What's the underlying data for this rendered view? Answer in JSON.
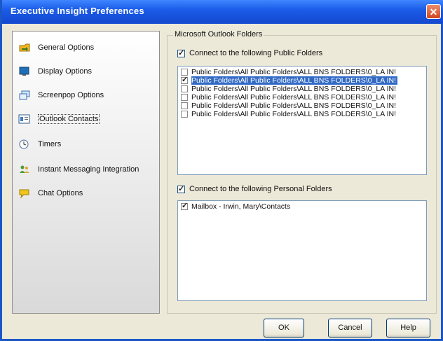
{
  "window": {
    "title": "Executive Insight Preferences",
    "close_glyph": "✕"
  },
  "sidebar": {
    "items": [
      {
        "label": "General Options",
        "icon": "folder-arrow-icon"
      },
      {
        "label": "Display Options",
        "icon": "monitor-icon"
      },
      {
        "label": "Screenpop Options",
        "icon": "screenpop-icon"
      },
      {
        "label": "Outlook Contacts",
        "icon": "contact-card-icon",
        "selected": true
      },
      {
        "label": "Timers",
        "icon": "clock-icon"
      },
      {
        "label": "Instant Messaging Integration",
        "icon": "users-icon"
      },
      {
        "label": "Chat Options",
        "icon": "chat-bubble-icon"
      }
    ]
  },
  "outlook": {
    "group_title": "Microsoft Outlook Folders",
    "public": {
      "label": "Connect to the following Public Folders",
      "checked": true,
      "folders": [
        {
          "text": "Public Folders\\All Public Folders\\ALL BNS FOLDERS\\0_LA IN!",
          "checked": false,
          "selected": false
        },
        {
          "text": "Public Folders\\All Public Folders\\ALL BNS FOLDERS\\0_LA IN!",
          "checked": true,
          "selected": true
        },
        {
          "text": "Public Folders\\All Public Folders\\ALL BNS FOLDERS\\0_LA IN!",
          "checked": false,
          "selected": false
        },
        {
          "text": "Public Folders\\All Public Folders\\ALL BNS FOLDERS\\0_LA IN!",
          "checked": false,
          "selected": false
        },
        {
          "text": "Public Folders\\All Public Folders\\ALL BNS FOLDERS\\0_LA IN!",
          "checked": false,
          "selected": false
        },
        {
          "text": "Public Folders\\All Public Folders\\ALL BNS FOLDERS\\0_LA IN!",
          "checked": false,
          "selected": false
        }
      ]
    },
    "personal": {
      "label": "Connect to the following Personal Folders",
      "checked": true,
      "folders": [
        {
          "text": "Mailbox - Irwin, Mary\\Contacts",
          "checked": true,
          "selected": false
        }
      ]
    }
  },
  "buttons": {
    "ok": "OK",
    "cancel": "Cancel",
    "help": "Help"
  }
}
